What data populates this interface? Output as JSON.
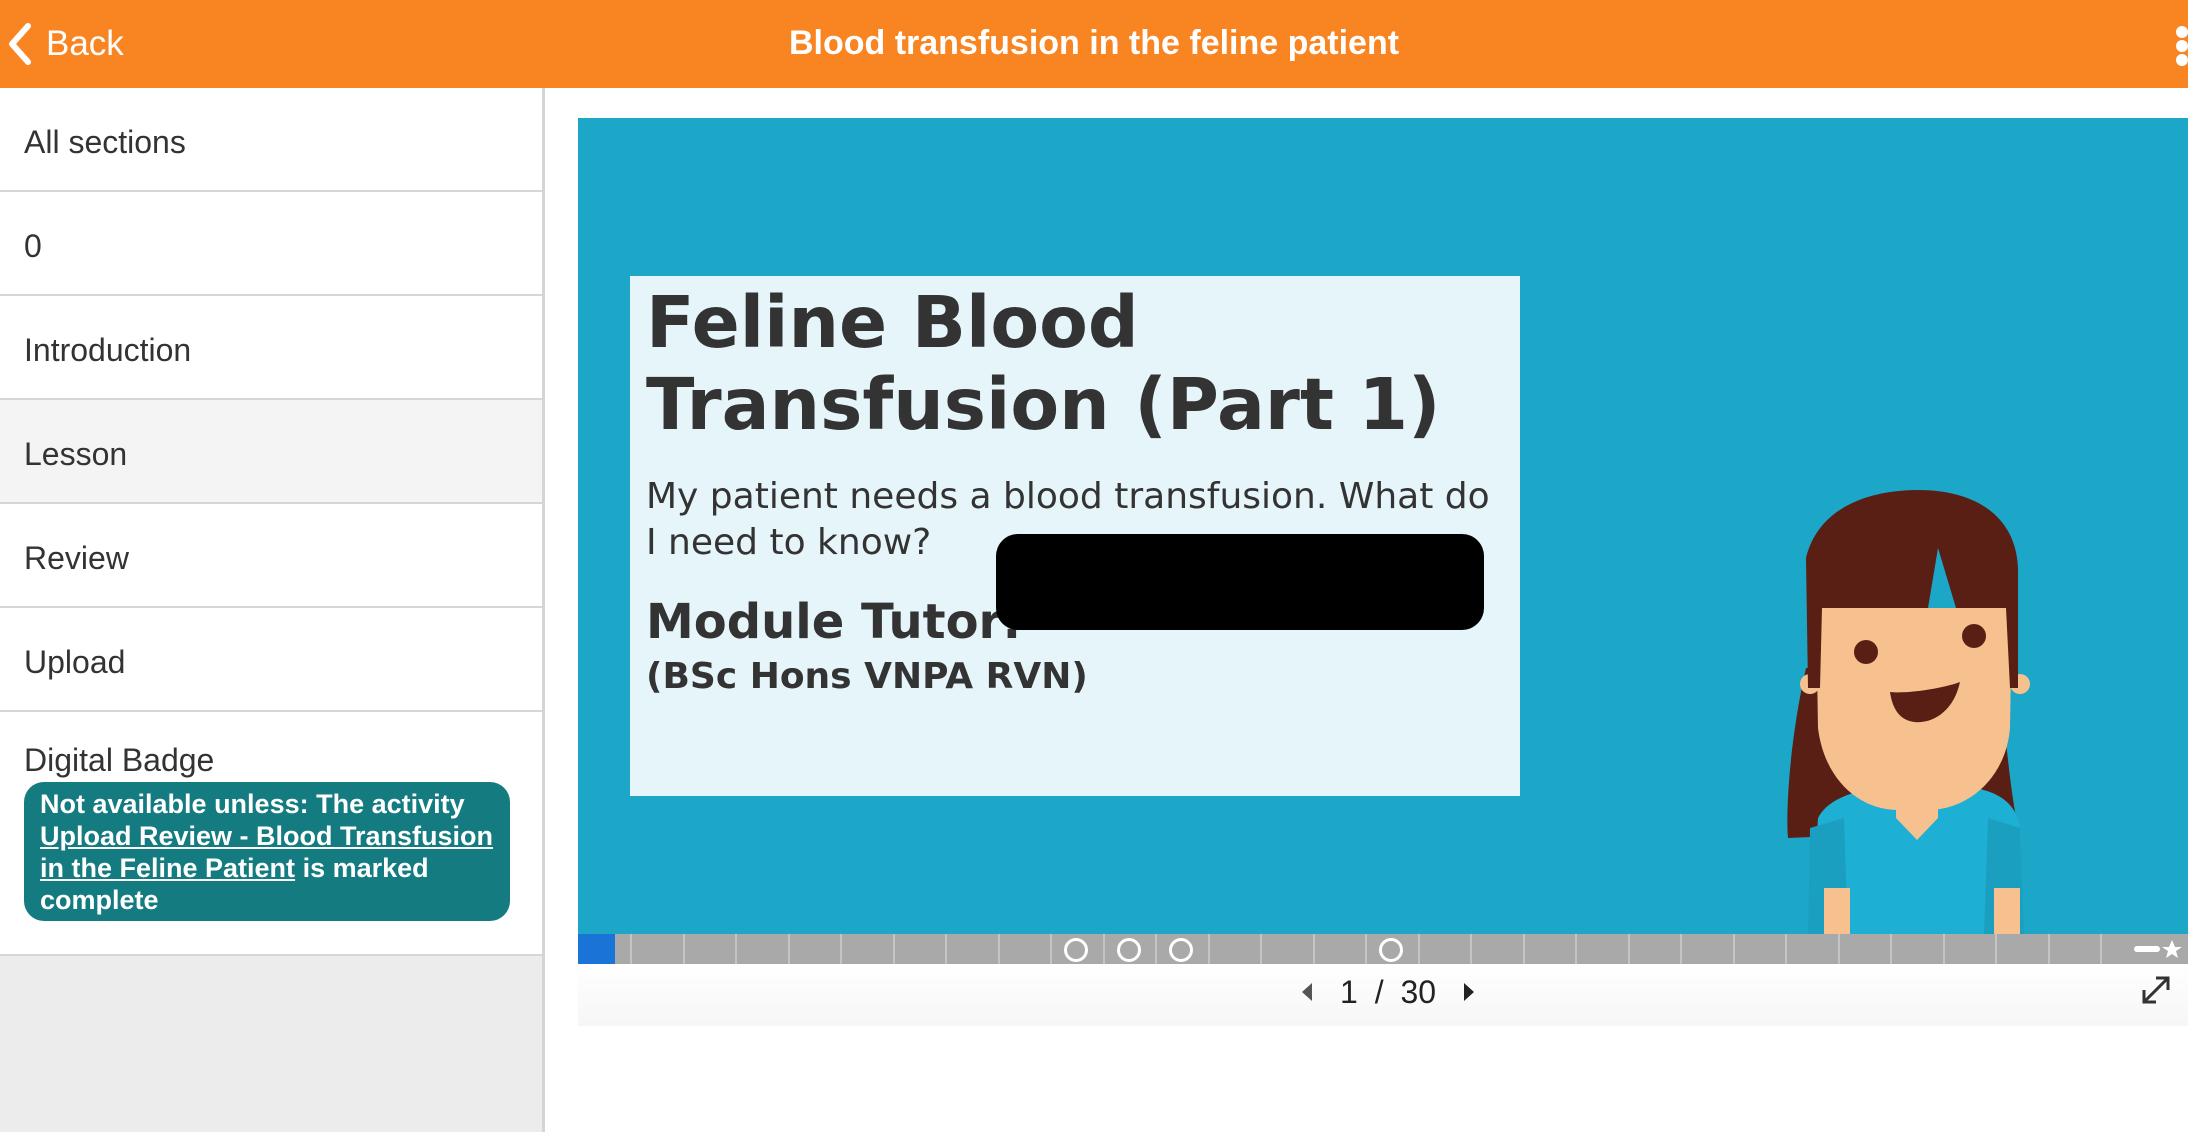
{
  "header": {
    "back_label": "Back",
    "title": "Blood transfusion in the feline patient",
    "bg_color": "#f98522"
  },
  "sidebar": {
    "items": [
      {
        "label": "All sections"
      },
      {
        "label": "0"
      },
      {
        "label": "Introduction"
      },
      {
        "label": "Lesson",
        "active": true
      },
      {
        "label": "Review"
      },
      {
        "label": "Upload"
      },
      {
        "label": "Digital Badge"
      }
    ],
    "restriction": {
      "prefix": "Not available unless: The activity",
      "link": "Upload Review - Blood Transfusion in the Feline Patient",
      "suffix": "is marked complete",
      "color": "#147b80"
    }
  },
  "slide": {
    "title": "Feline Blood Transfusion (Part 1)",
    "subtitle": "My patient needs a blood transfusion. What do I need to know?",
    "tutor_label": "Module Tutor:",
    "tutor_credentials": "(BSc Hons VNPA RVN)",
    "bg_color": "#1ca7c9",
    "card_color": "#e6f5fa"
  },
  "player": {
    "current_page": "1",
    "separator": "/",
    "total_pages": "30",
    "progress": 0.023,
    "progress_color": "#1a73d6"
  }
}
